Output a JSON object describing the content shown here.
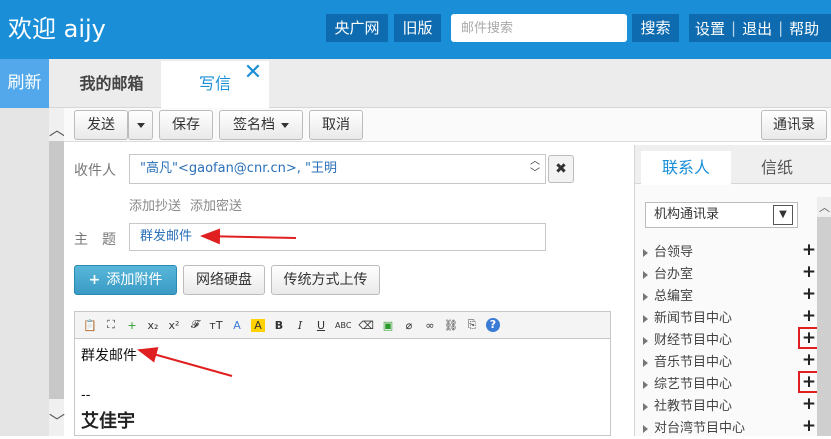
{
  "header": {
    "welcome": "欢迎 aijy",
    "btn_cnr": "央广网",
    "btn_old": "旧版",
    "search_placeholder": "邮件搜索",
    "btn_search": "搜索",
    "settings": "设置",
    "logout": "退出",
    "help": "帮助"
  },
  "sidebar": {
    "refresh": "刷新"
  },
  "tabs": {
    "inbox": "我的邮箱",
    "compose": "写信",
    "close": "✕"
  },
  "toolbar": {
    "send": "发送",
    "save": "保存",
    "signature": "签名档",
    "cancel": "取消",
    "address_book": "通讯录"
  },
  "form": {
    "recipients_label": "收件人",
    "recipients_value": "\"高凡\"<gaofan@cnr.cn>, \"王明",
    "add_cc": "添加抄送",
    "add_bcc": "添加密送",
    "subject_label": "主　题",
    "subject_value": "群发邮件"
  },
  "attach": {
    "add_attachment": "添加附件",
    "netdisk": "网络硬盘",
    "traditional": "传统方式上传"
  },
  "editor": {
    "toolbar_icons": [
      "📋",
      "⛶",
      "+",
      "x₂",
      "x²",
      "𝓕",
      "тT",
      "A",
      "A",
      "B",
      "I",
      "U",
      "ABC",
      "⌫",
      "▣",
      "⌀",
      "∞",
      "⛓",
      "⎘",
      "?"
    ],
    "body_line1": "群发邮件",
    "body_sep": "--",
    "body_signature": "艾佳宇"
  },
  "sidepanel": {
    "tab_contacts": "联系人",
    "tab_stationery": "信纸",
    "dropdown_value": "机构通讯录",
    "orgs": [
      {
        "name": "台领导",
        "highlight": false
      },
      {
        "name": "台办室",
        "highlight": false
      },
      {
        "name": "总编室",
        "highlight": false
      },
      {
        "name": "新闻节目中心",
        "highlight": false
      },
      {
        "name": "财经节目中心",
        "highlight": true
      },
      {
        "name": "音乐节目中心",
        "highlight": false
      },
      {
        "name": "综艺节目中心",
        "highlight": true
      },
      {
        "name": "社教节目中心",
        "highlight": false
      },
      {
        "name": "对台湾节目中心",
        "highlight": false
      }
    ]
  },
  "annotation_color": "#e02020"
}
